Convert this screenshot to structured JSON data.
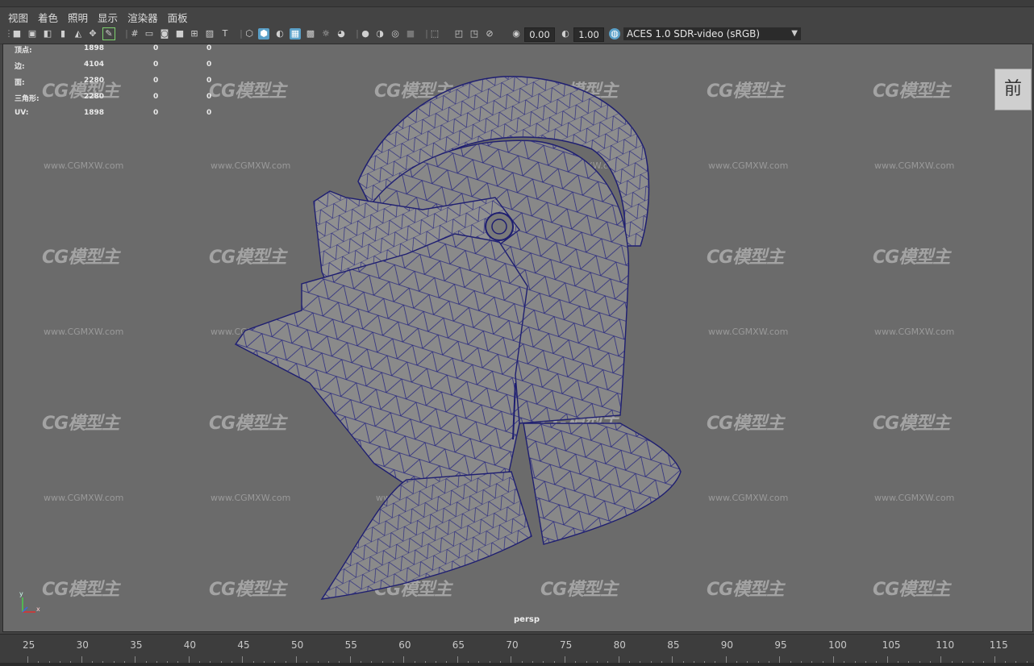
{
  "menu": [
    "视图",
    "着色",
    "照明",
    "显示",
    "渲染器",
    "面板"
  ],
  "toolbar": {
    "exposure": "0.00",
    "gamma": "1.00",
    "color_space": "ACES 1.0 SDR-video (sRGB)"
  },
  "hud": {
    "rows": [
      {
        "label": "顶点:",
        "v1": "1898",
        "v2": "0",
        "v3": "0"
      },
      {
        "label": "边:",
        "v1": "4104",
        "v2": "0",
        "v3": "0"
      },
      {
        "label": "面:",
        "v1": "2280",
        "v2": "0",
        "v3": "0"
      },
      {
        "label": "三角形:",
        "v1": "2280",
        "v2": "0",
        "v3": "0"
      },
      {
        "label": "UV:",
        "v1": "1898",
        "v2": "0",
        "v3": "0"
      }
    ]
  },
  "view_cube_label": "前",
  "camera_name": "persp",
  "watermark": {
    "logo": "CG模型主",
    "url": "www.CGMXW.com"
  },
  "axis": {
    "y": "y",
    "x": "x"
  },
  "timeline": {
    "labels": [
      "25",
      "30",
      "35",
      "40",
      "45",
      "50",
      "55",
      "60",
      "65",
      "70",
      "75",
      "80",
      "85",
      "90",
      "95",
      "100",
      "105",
      "110",
      "115"
    ]
  },
  "colors": {
    "viewport_bg": "#6b6b6b",
    "wire": "#2a2a80",
    "mesh": "#8b8b8b",
    "accent": "#5aa0c8"
  }
}
